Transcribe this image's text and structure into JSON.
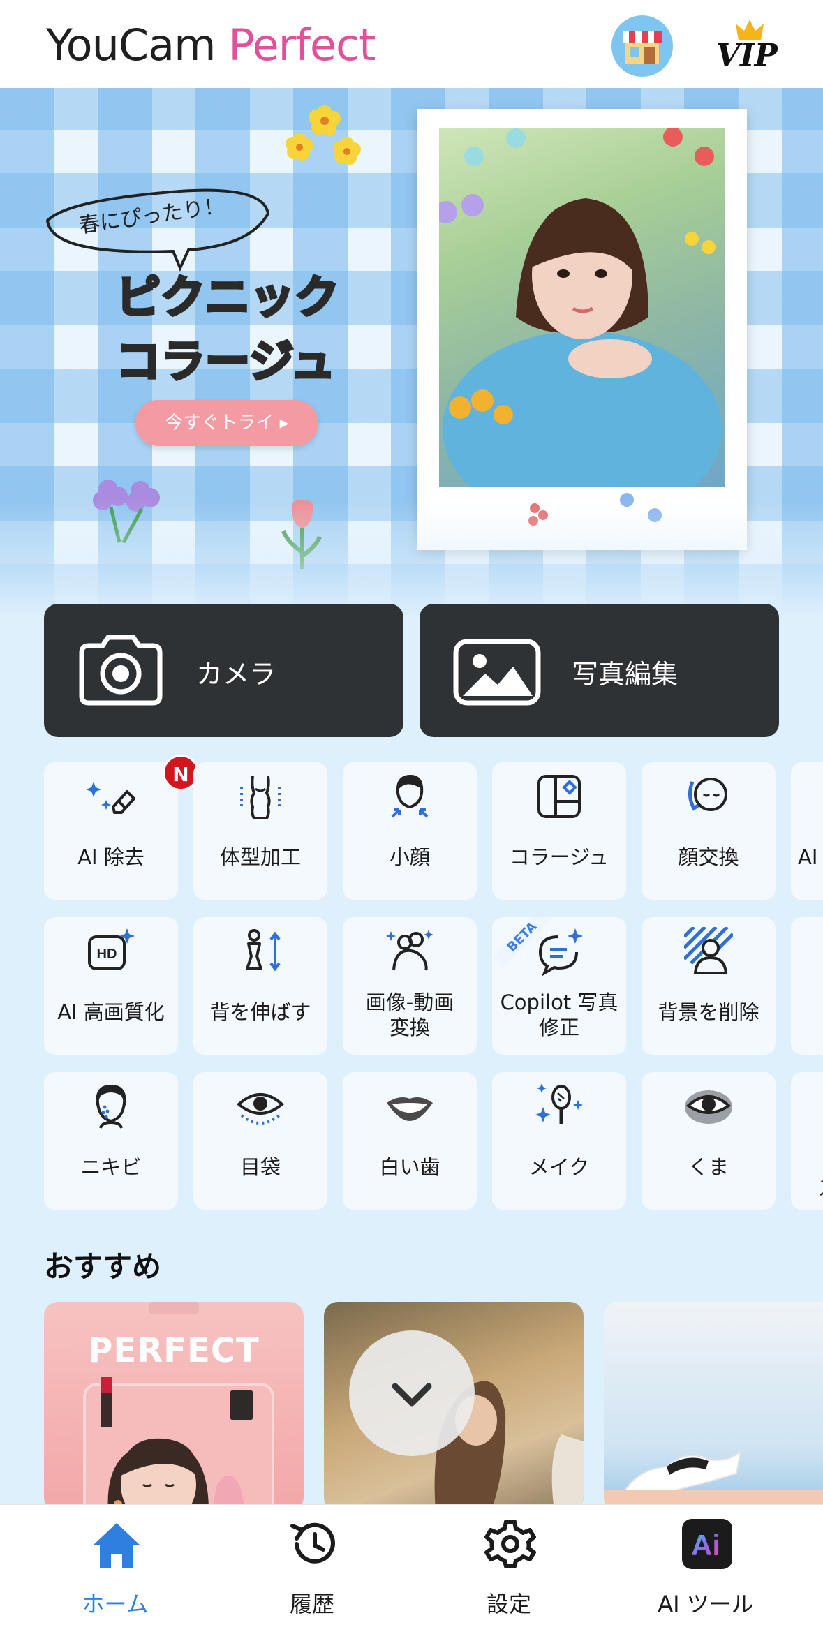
{
  "header": {
    "logo_part1": "YouCam",
    "logo_part2": "Perfect",
    "vip_label": "VIP",
    "shop_icon": "shop-icon",
    "colors": {
      "logo_dark": "#1f1f1f",
      "logo_pink": "#e0519a"
    }
  },
  "banner": {
    "bubble_text": "春にぴったり！",
    "title_line1": "ピクニック",
    "title_line2": "コラージュ",
    "cta_label": "今すぐトライ ▸",
    "cta_color": "#f39aa3"
  },
  "main_buttons": {
    "camera_label": "カメラ",
    "camera_icon": "camera-icon",
    "photo_edit_label": "写真編集",
    "photo_edit_icon": "image-icon"
  },
  "tools": {
    "row1": [
      "AI 除去",
      "体型加工",
      "小顔",
      "コラージュ",
      "顔交換",
      "AI"
    ],
    "row2": [
      "AI 高画質化",
      "背を伸ばす",
      "画像-動画\n変換",
      "Copilot 写真\n修正",
      "背景を削除"
    ],
    "row3": [
      "ニキビ",
      "目袋",
      "白い歯",
      "メイク",
      "くま"
    ],
    "row3_partial": "ス",
    "new_badge": "N",
    "beta_label": "BETA"
  },
  "recommend": {
    "title": "おすすめ",
    "card1_text": "PERFECT"
  },
  "bottom_nav": {
    "items": [
      {
        "label": "ホーム",
        "icon": "home-icon",
        "active": true
      },
      {
        "label": "履歴",
        "icon": "history-icon",
        "active": false
      },
      {
        "label": "設定",
        "icon": "gear-icon",
        "active": false
      },
      {
        "label": "AI ツール",
        "icon": "ai-tools-icon",
        "active": false
      }
    ],
    "active_color": "#2f7fe0"
  }
}
